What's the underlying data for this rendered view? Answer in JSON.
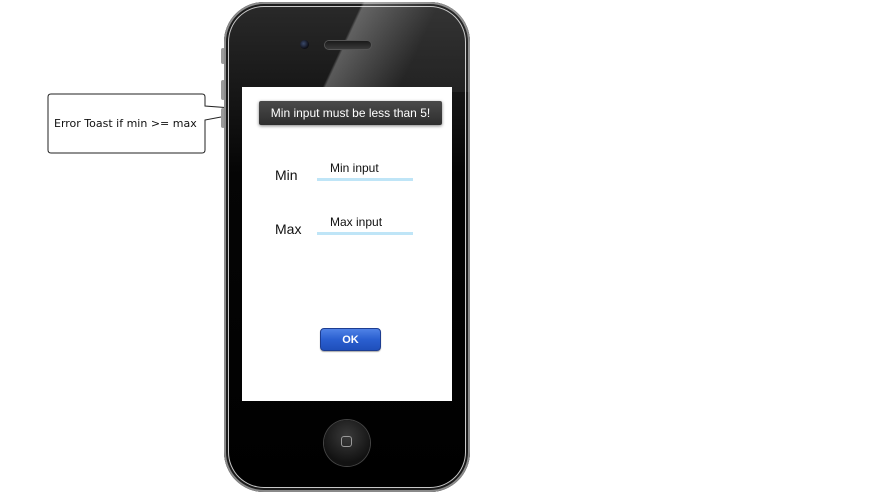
{
  "annotation": {
    "callout_text": "Error Toast if min >= max"
  },
  "toast": {
    "message": "Min input must be less than 5!"
  },
  "form": {
    "min_label": "Min",
    "min_placeholder": "Min input",
    "max_label": "Max",
    "max_placeholder": "Max input",
    "ok_label": "OK"
  },
  "colors": {
    "ok_button": "#2a5fd0",
    "toast_bg": "#383838",
    "input_underline": "#bfe5f7"
  }
}
